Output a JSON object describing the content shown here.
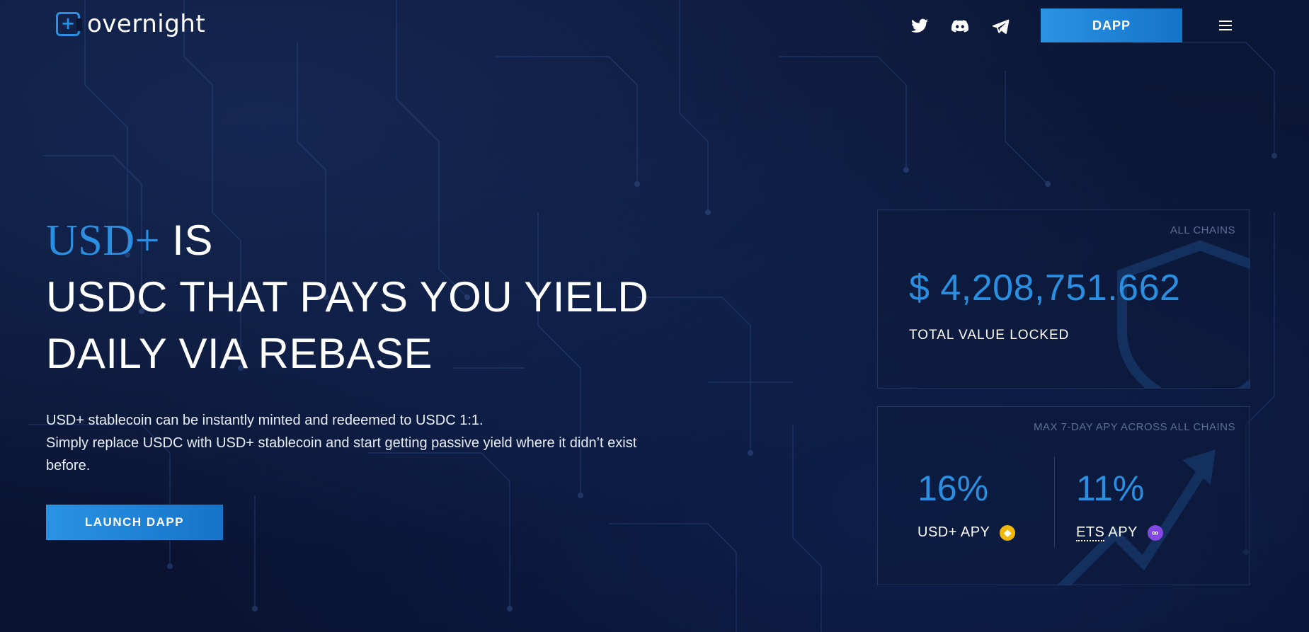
{
  "brand": {
    "name": "overnight",
    "accent_color": "#2a8fe0"
  },
  "nav": {
    "socials": [
      {
        "name": "twitter-icon"
      },
      {
        "name": "discord-icon"
      },
      {
        "name": "telegram-icon"
      }
    ],
    "dapp_label": "DAPP",
    "menu_icon": "hamburger-menu-icon"
  },
  "hero": {
    "title_accent": "USD+",
    "title_rest": " IS",
    "title_line2": "USDC THAT PAYS YOU YIELD",
    "title_line3": "DAILY VIA REBASE",
    "description_line1": "USD+ stablecoin can be instantly minted and redeemed to USDC 1:1.",
    "description_line2": "Simply replace USDC with USD+ stablecoin and start getting passive yield where it didn’t exist before.",
    "cta_label": "LAUNCH DAPP"
  },
  "tvl_card": {
    "scope_label": "ALL CHAINS",
    "value": "$ 4,208,751.662",
    "caption": "TOTAL VALUE LOCKED"
  },
  "apy_card": {
    "scope_label": "MAX 7-DAY APY ACROSS ALL CHAINS",
    "usd_plus": {
      "value": "16%",
      "label": "USD+ APY",
      "chain_icon": "bnb-chain-icon"
    },
    "ets": {
      "value": "11%",
      "label_prefix": "ETS",
      "label_suffix": " APY",
      "chain_icon": "polygon-chain-icon"
    }
  }
}
